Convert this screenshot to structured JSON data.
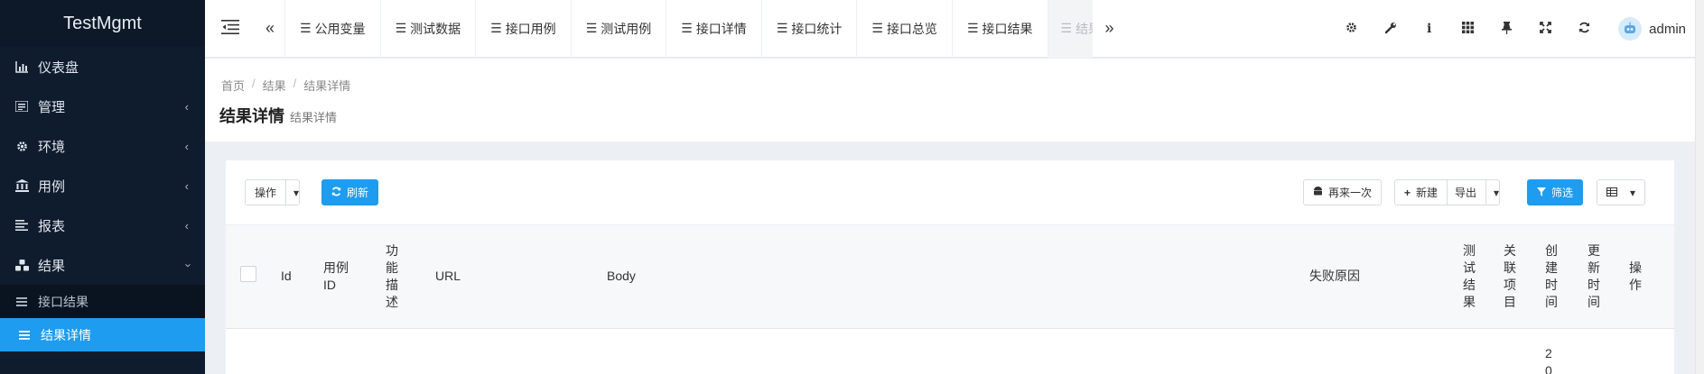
{
  "brand": "TestMgmt",
  "sidebar": {
    "items": [
      {
        "label": "仪表盘",
        "icon": "bar-chart-icon"
      },
      {
        "label": "管理",
        "icon": "list-icon"
      },
      {
        "label": "环境",
        "icon": "gear-icon"
      },
      {
        "label": "用例",
        "icon": "bank-icon"
      },
      {
        "label": "报表",
        "icon": "report-icon"
      },
      {
        "label": "结果",
        "icon": "cubes-icon"
      }
    ],
    "submenu": [
      {
        "label": "接口结果",
        "icon": "bars-icon"
      },
      {
        "label": "结果详情",
        "icon": "bars-icon"
      }
    ]
  },
  "topbar": {
    "tabs": [
      "公用变量",
      "测试数据",
      "接口用例",
      "测试用例",
      "接口详情",
      "接口统计",
      "接口总览",
      "接口结果",
      "结果详情"
    ],
    "user": "admin"
  },
  "breadcrumb": [
    "首页",
    "结果",
    "结果详情"
  ],
  "page": {
    "title": "结果详情",
    "subtitle": "结果详情"
  },
  "toolbar": {
    "actions_label": "操作",
    "refresh_label": "刷新",
    "retry_label": "再来一次",
    "new_label": "新建",
    "export_label": "导出",
    "filter_label": "筛选"
  },
  "table": {
    "columns": [
      "Id",
      "用例ID",
      "功能描述",
      "URL",
      "Body",
      "失败原因",
      "测试结果",
      "关联项目",
      "创建时间",
      "更新时间",
      "操作"
    ],
    "row_partial": "20"
  },
  "colors": {
    "accent": "#1e9cef",
    "sidebar": "#0f1c2e"
  }
}
